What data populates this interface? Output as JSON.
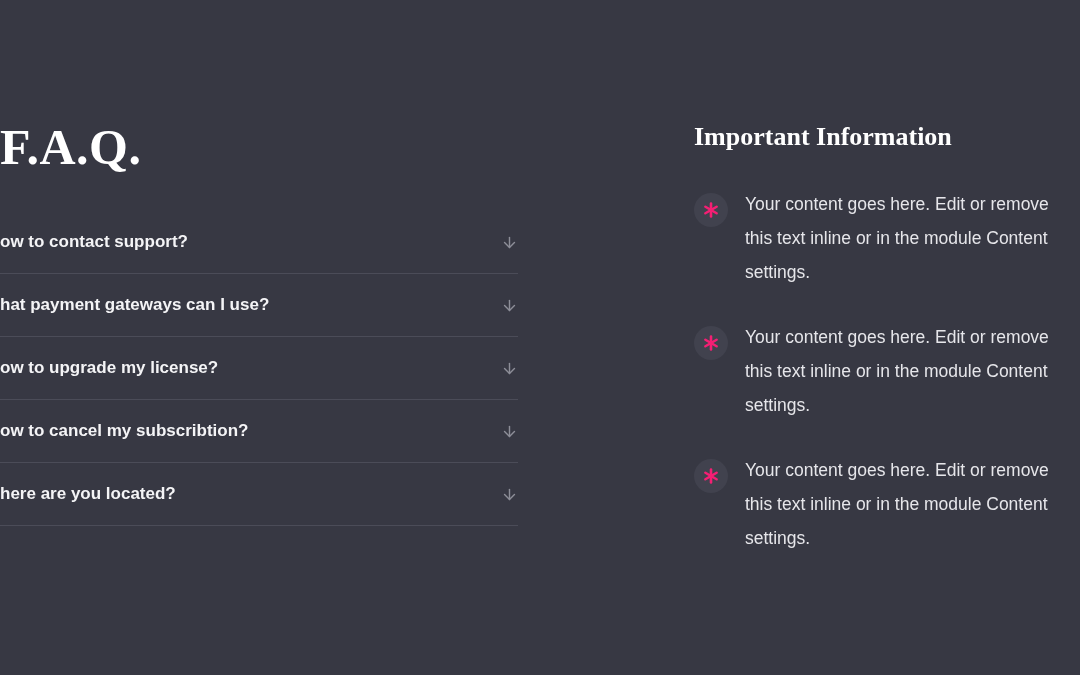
{
  "faq": {
    "title": "F.A.Q.",
    "items": [
      {
        "question": "ow to contact support?",
        "expanded": false
      },
      {
        "question": "hat payment gateways can I use?",
        "expanded": false
      },
      {
        "question": "ow to upgrade my license?",
        "expanded": false
      },
      {
        "question": "ow to cancel my subscribtion?",
        "expanded": false
      },
      {
        "question": "here are you located?",
        "expanded": false
      }
    ]
  },
  "info": {
    "title": "Important Information",
    "items": [
      {
        "text": "Your content goes here. Edit or remove this text inline or in the module Content settings."
      },
      {
        "text": "Your content goes here. Edit or remove this text inline or in the module Content settings."
      },
      {
        "text": "Your content goes here. Edit or remove this text inline or in the module Content settings."
      }
    ]
  }
}
